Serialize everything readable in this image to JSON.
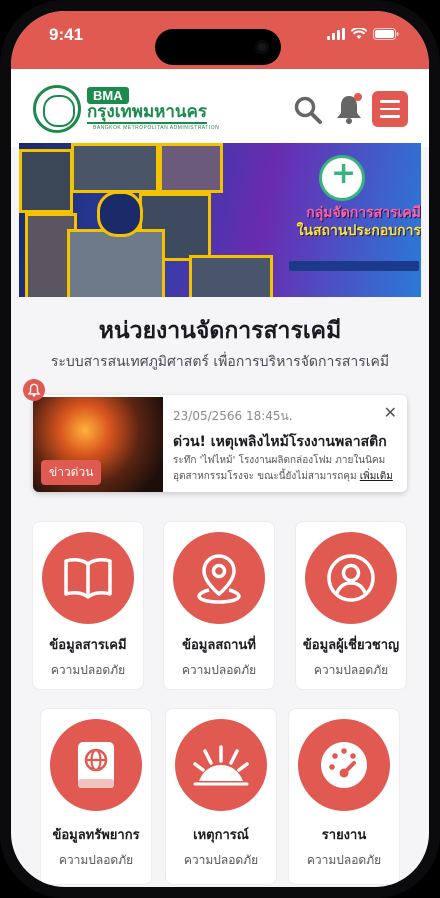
{
  "status_bar": {
    "time": "9:41"
  },
  "header": {
    "logo": {
      "bma": "BMA",
      "thai_name": "กรุงเทพมหานคร",
      "english_name": "BANGKOK METROPOLITAN ADMINISTRATION"
    }
  },
  "banner": {
    "title_line1": "กลุ่มจัดการสารเคมี",
    "title_line2": "ในสถานประกอบการ"
  },
  "page": {
    "title": "หน่วยงานจัดการสารเคมี",
    "subtitle": "ระบบสารสนเทศภูมิศาสตร์ เพื่อการบริหารจัดการสารเคมี"
  },
  "news": {
    "tag": "ข่าวด่วน",
    "date": "23/05/2566 18:45น.",
    "headline": "ด่วน! เหตุเพลิงไหม้โรงงานพลาสติก",
    "body": "ระทึก 'ไฟไหม้' โรงงานผลิตกล่องโฟม ภายในนิคมอุตสาหกรรมโรงจะ ขณะนี้ยังไม่สามารถคุม",
    "more": "เพิ่มเติม"
  },
  "tiles": [
    {
      "title": "ข้อมูลสารเคมี",
      "subtitle": "ความปลอดภัย",
      "icon": "book-icon"
    },
    {
      "title": "ข้อมูลสถานที่",
      "subtitle": "ความปลอดภัย",
      "icon": "location-pin-icon"
    },
    {
      "title": "ข้อมูลผู้เชี่ยวชาญ",
      "subtitle": "ความปลอดภัย",
      "icon": "user-icon"
    },
    {
      "title": "ข้อมูลทรัพยากร",
      "subtitle": "ความปลอดภัย",
      "icon": "globe-book-icon"
    },
    {
      "title": "เหตุการณ์",
      "subtitle": "ความปลอดภัย",
      "icon": "explosion-icon"
    },
    {
      "title": "รายงาน",
      "subtitle": "ความปลอดภัย",
      "icon": "gauge-icon"
    }
  ],
  "colors": {
    "accent": "#e15a52",
    "brand_green": "#1d8a4d"
  }
}
